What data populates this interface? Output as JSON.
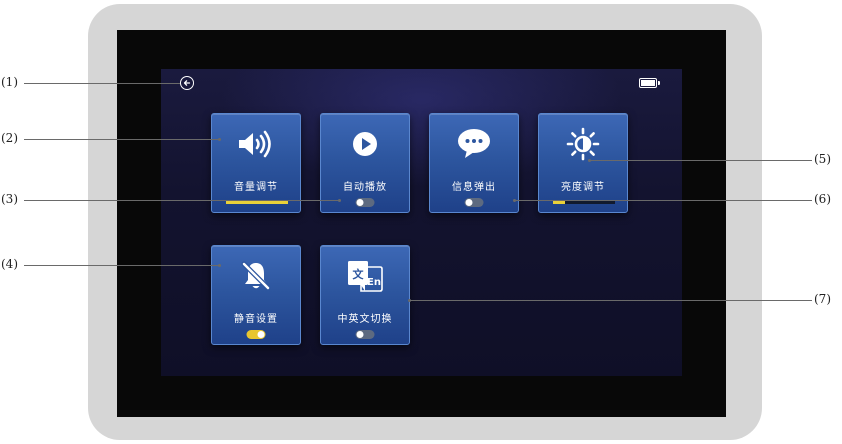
{
  "screen": {
    "back_icon": "arrow-left-circle-icon",
    "battery_icon": "battery-full-icon",
    "battery_level": 1.0,
    "accent_color": "#e8c62f",
    "tile_color": "#2d569f"
  },
  "tiles": [
    {
      "label": "音量调节",
      "icon": "speaker-volume-icon",
      "control": "slider",
      "level": 1.0
    },
    {
      "label": "自动播放",
      "icon": "play-circle-icon",
      "control": "toggle",
      "on": false
    },
    {
      "label": "信息弹出",
      "icon": "chat-bubble-icon",
      "control": "toggle",
      "on": false
    },
    {
      "label": "亮度调节",
      "icon": "sun-brightness-icon",
      "control": "slider",
      "level": 0.2
    },
    {
      "label": "静音设置",
      "icon": "bell-muted-icon",
      "control": "toggle",
      "on": true
    },
    {
      "label": "中英文切换",
      "icon": "language-switch-icon",
      "control": "toggle",
      "on": false
    }
  ],
  "language_icon_text": {
    "zh": "文",
    "en": "En"
  },
  "callouts": [
    "(1)",
    "(2)",
    "(3)",
    "(4)",
    "(5)",
    "(6)",
    "(7)"
  ]
}
